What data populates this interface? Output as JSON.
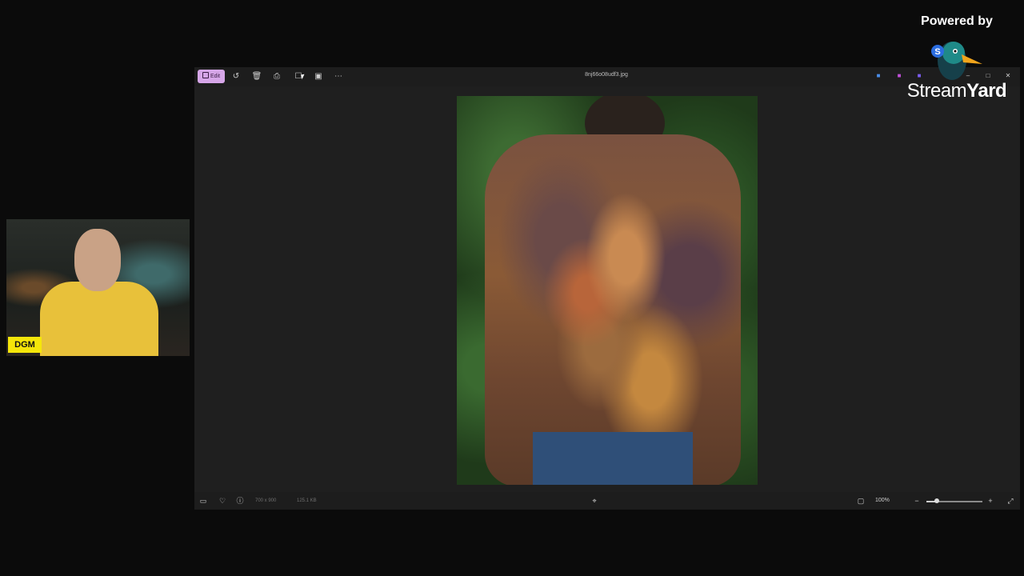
{
  "viewer": {
    "toolbar": {
      "edit_label": "Edit",
      "file_title": "8nj66o08udf3.jpg",
      "icons": [
        "rotate-icon",
        "delete-icon",
        "print-icon",
        "crop-icon",
        "slideshow-icon",
        "more-icon"
      ]
    },
    "status": {
      "dimensions": "700 x 900",
      "file_size": "125.1 KB",
      "zoom": "100%",
      "zoom_level_fraction": 0.18
    }
  },
  "overlay": {
    "name_tag": "DGM",
    "powered_by": "Powered by",
    "brand_stream": "Stream",
    "brand_yard": "Yard",
    "name_tag_color": "#f5e60a",
    "edit_accent": "#d6a6e8"
  }
}
